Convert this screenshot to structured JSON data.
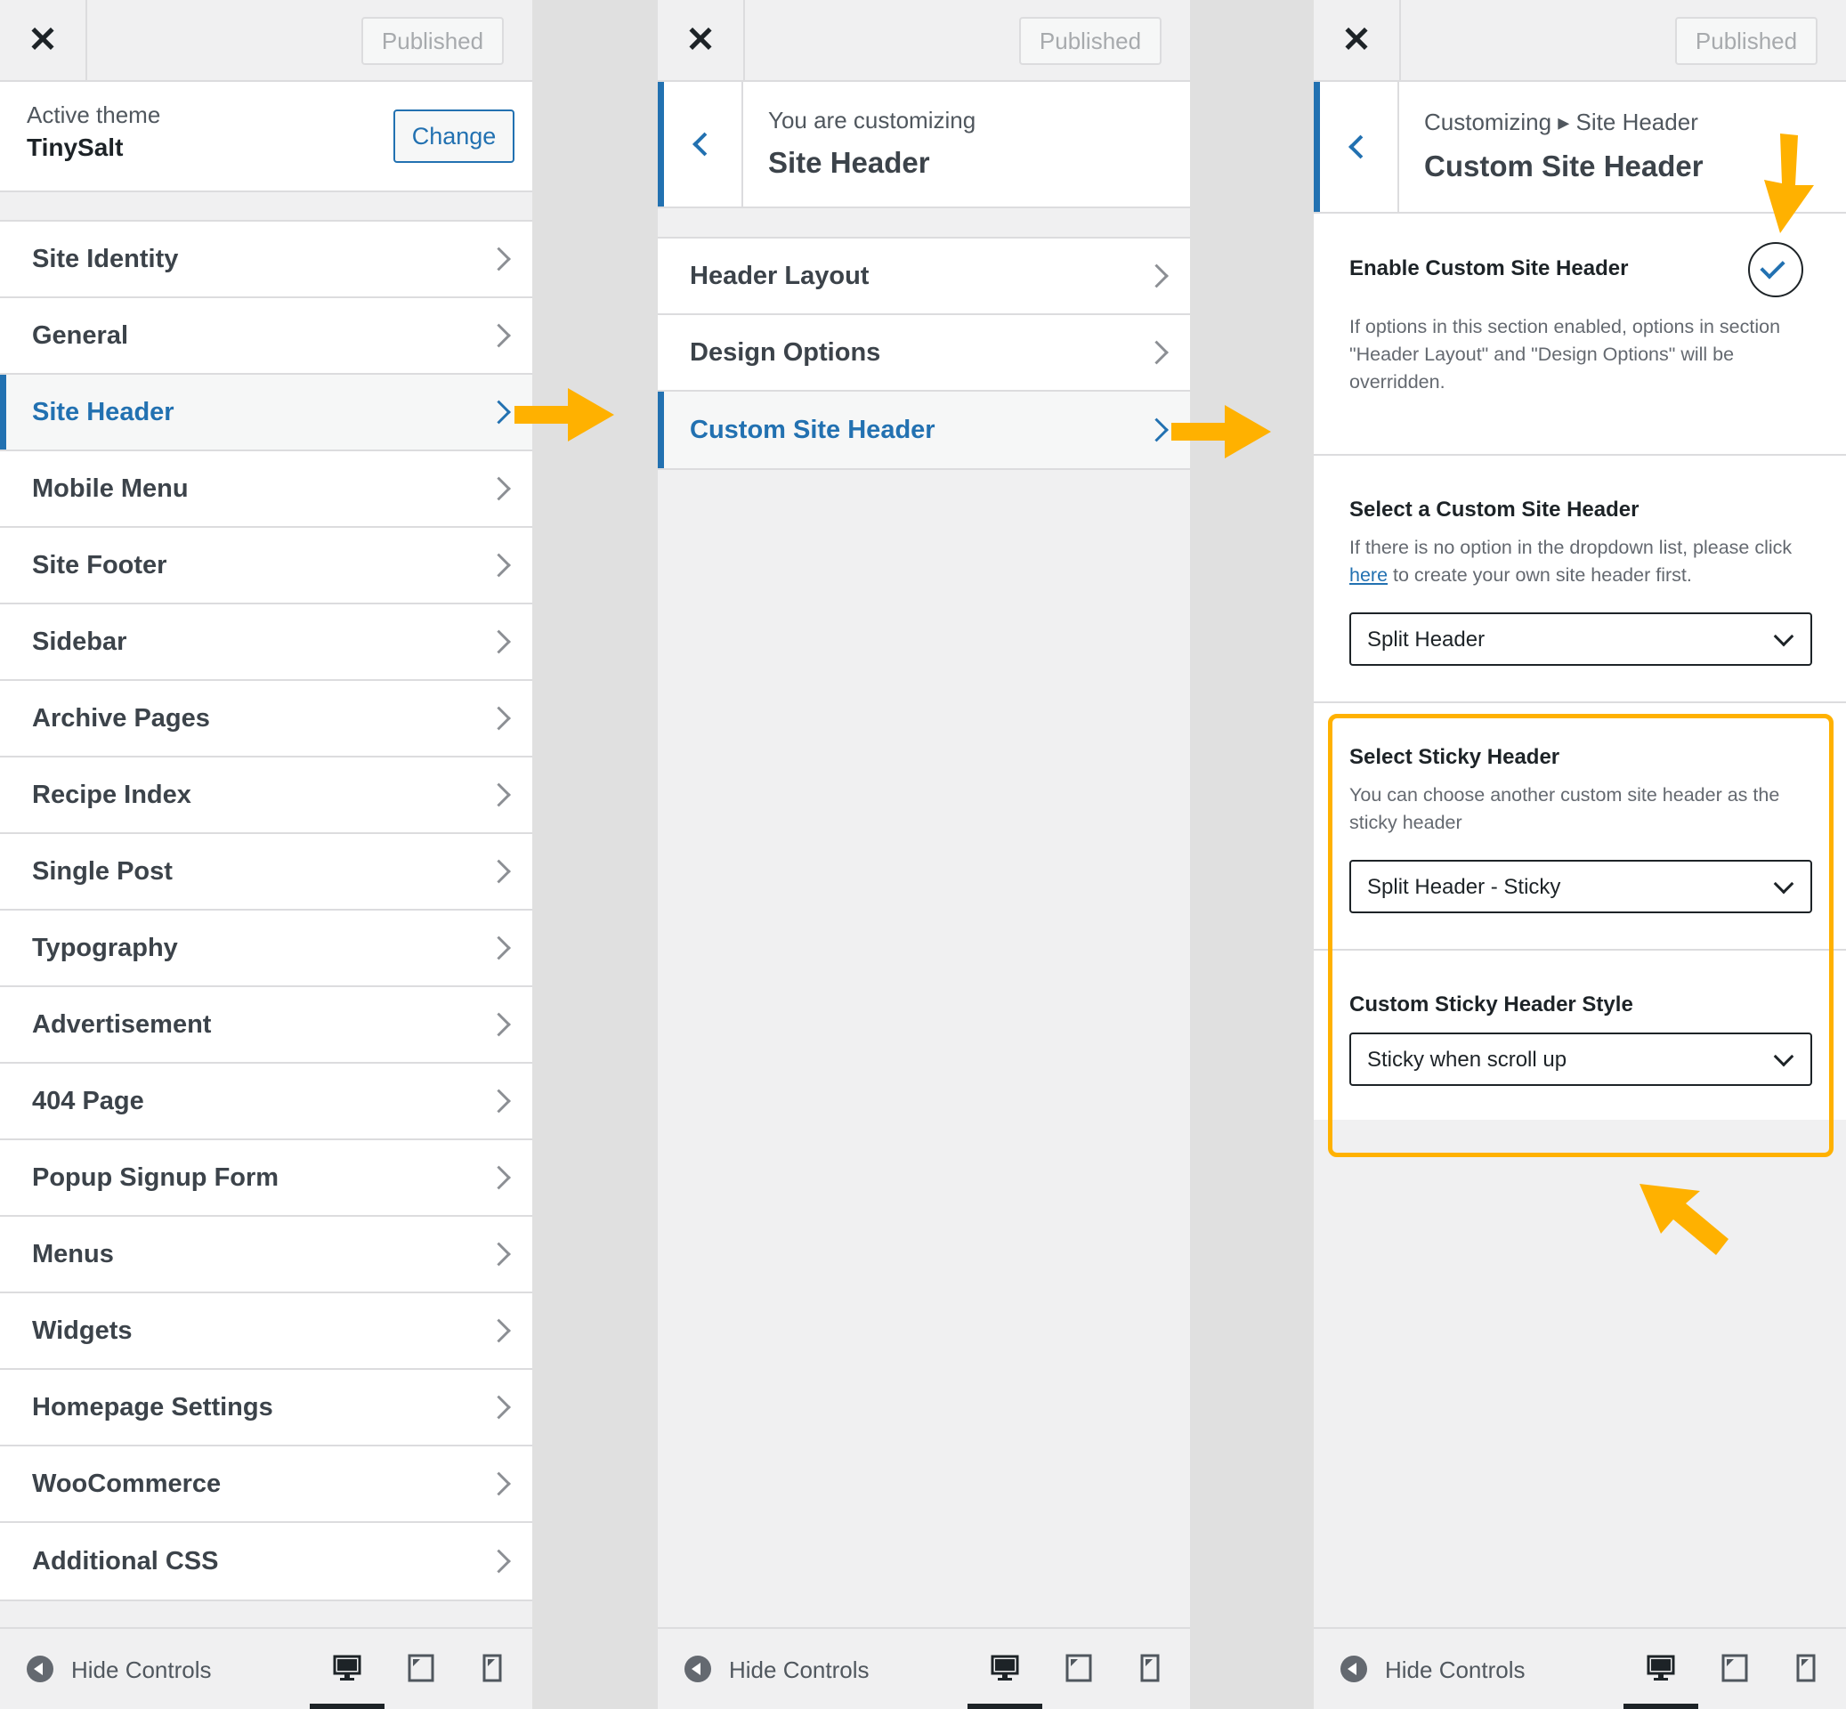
{
  "common": {
    "close_glyph": "✕",
    "published_label": "Published",
    "hide_controls_label": "Hide Controls"
  },
  "panel1": {
    "active_theme_label": "Active theme",
    "theme_name": "TinySalt",
    "change_label": "Change",
    "items": [
      {
        "label": "Site Identity"
      },
      {
        "label": "General"
      },
      {
        "label": "Site Header",
        "active": true
      },
      {
        "label": "Mobile Menu"
      },
      {
        "label": "Site Footer"
      },
      {
        "label": "Sidebar"
      },
      {
        "label": "Archive Pages"
      },
      {
        "label": "Recipe Index"
      },
      {
        "label": "Single Post"
      },
      {
        "label": "Typography"
      },
      {
        "label": "Advertisement"
      },
      {
        "label": "404 Page"
      },
      {
        "label": "Popup Signup Form"
      },
      {
        "label": "Menus"
      },
      {
        "label": "Widgets"
      },
      {
        "label": "Homepage Settings"
      },
      {
        "label": "WooCommerce"
      },
      {
        "label": "Additional CSS"
      }
    ]
  },
  "panel2": {
    "sub_label": "You are customizing",
    "title": "Site Header",
    "items": [
      {
        "label": "Header Layout"
      },
      {
        "label": "Design Options"
      },
      {
        "label": "Custom Site Header",
        "active": true
      }
    ]
  },
  "panel3": {
    "breadcrumb": "Customizing ▸ Site Header",
    "title": "Custom Site Header",
    "enable_title": "Enable Custom Site Header",
    "enable_desc": "If options in this section enabled, options in section \"Header Layout\" and \"Design Options\" will be overridden.",
    "enable_checked": true,
    "select_title": "Select a Custom Site Header",
    "select_desc_before": "If there is no option in the dropdown list, please click ",
    "select_desc_link": "here",
    "select_desc_after": " to create your own site header first.",
    "select_value": "Split Header",
    "sticky_title": "Select Sticky Header",
    "sticky_desc": "You can choose another custom site header as the sticky header",
    "sticky_value": "Split Header - Sticky",
    "style_title": "Custom Sticky Header Style",
    "style_value": "Sticky when scroll up"
  },
  "colors": {
    "accent": "#2271b1",
    "highlight": "#ffb100",
    "arrow": "#ffb100"
  },
  "icons": [
    "close-icon",
    "chevron-right-icon",
    "chevron-left-icon",
    "check-icon",
    "dropdown-icon",
    "hide-controls-icon",
    "desktop-icon",
    "tablet-icon",
    "mobile-icon",
    "arrow-annotation"
  ]
}
